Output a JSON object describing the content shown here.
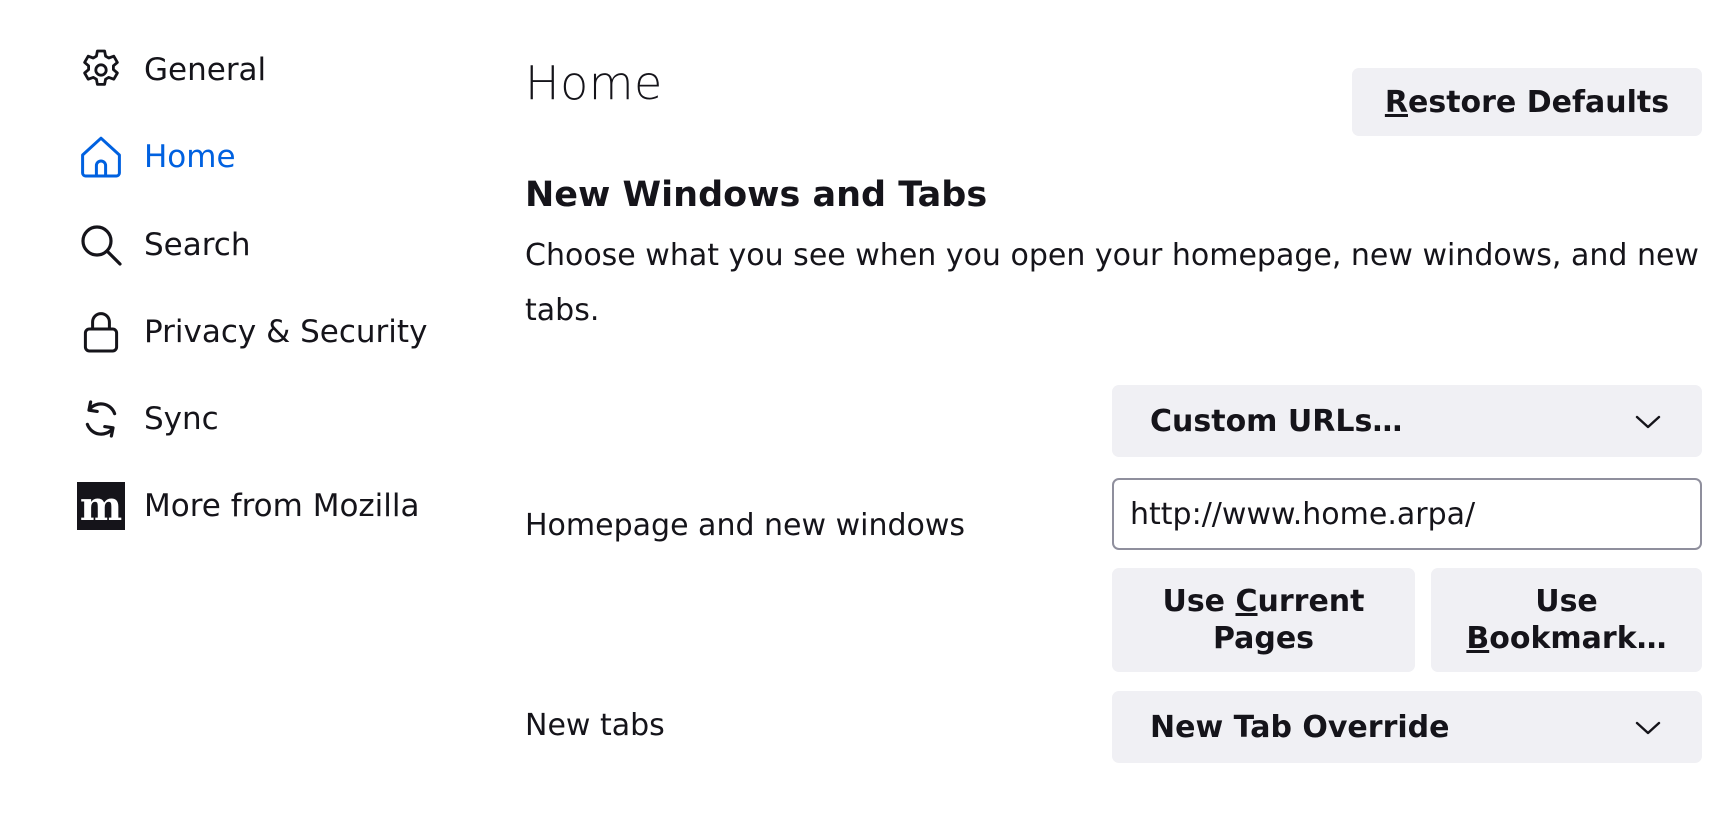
{
  "sidebar": {
    "items": [
      {
        "label": "General",
        "icon": "gear-icon"
      },
      {
        "label": "Home",
        "icon": "home-icon",
        "selected": true
      },
      {
        "label": "Search",
        "icon": "search-icon"
      },
      {
        "label": "Privacy & Security",
        "icon": "lock-icon"
      },
      {
        "label": "Sync",
        "icon": "sync-icon"
      },
      {
        "label": "More from Mozilla",
        "icon": "mozilla-logo-icon"
      }
    ]
  },
  "colors": {
    "accent": "#0061e0",
    "button_bg": "#f0f0f4",
    "text": "#15141a",
    "input_border": "#8f8f9d"
  },
  "main": {
    "title": "Home",
    "restore_defaults": {
      "accesskey": "R",
      "rest": "estore Defaults"
    },
    "section": {
      "title": "New Windows and Tabs",
      "description": "Choose what you see when you open your homepage, new windows, and new tabs."
    },
    "homepage": {
      "label": "Homepage and new windows",
      "select_value": "Custom URLs…",
      "url_value": "http://www.home.arpa/",
      "use_current_pages": {
        "pre": "Use ",
        "accesskey": "C",
        "rest": "urrent Pages"
      },
      "use_bookmark": {
        "pre": "Use ",
        "accesskey": "B",
        "rest": "ookmark…"
      }
    },
    "new_tabs": {
      "label": "New tabs",
      "select_value": "New Tab Override"
    }
  }
}
